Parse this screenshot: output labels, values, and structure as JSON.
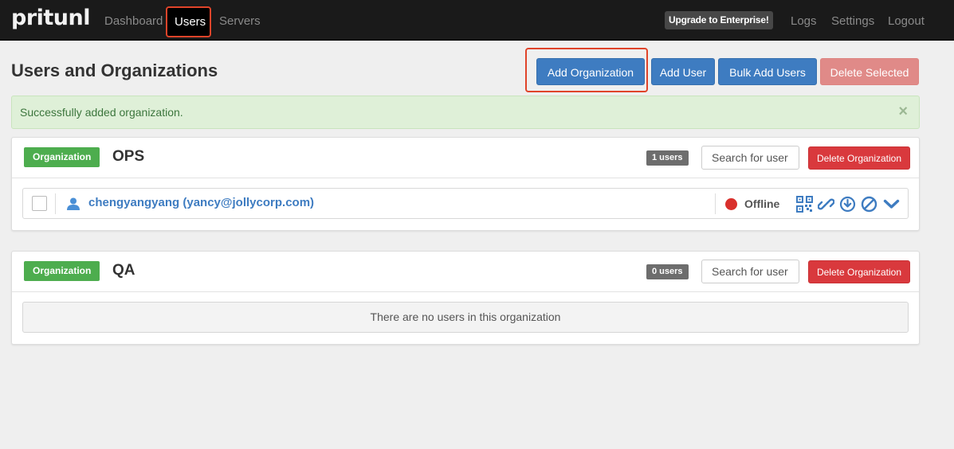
{
  "navbar": {
    "brand": "pritunl",
    "links": [
      "Dashboard",
      "Users",
      "Servers"
    ],
    "upgrade_label": "Upgrade to Enterprise!",
    "right_links": [
      "Logs",
      "Settings",
      "Logout"
    ]
  },
  "page": {
    "title": "Users and Organizations",
    "buttons": {
      "add_organization": "Add Organization",
      "add_user": "Add User",
      "bulk_add_users": "Bulk Add Users",
      "delete_selected": "Delete Selected"
    }
  },
  "alert": {
    "message": "Successfully added organization.",
    "close": "×"
  },
  "organizations": [
    {
      "label": "Organization",
      "name": "OPS",
      "user_count": "1 users",
      "search_placeholder": "Search for user",
      "delete_label": "Delete Organization",
      "users": [
        {
          "name": "chengyangyang (yancy@jollycorp.com)",
          "status": "Offline"
        }
      ]
    },
    {
      "label": "Organization",
      "name": "QA",
      "user_count": "0 users",
      "search_placeholder": "Search for user",
      "delete_label": "Delete Organization",
      "empty_message": "There are no users in this organization"
    }
  ],
  "colors": {
    "primary": "#3e7cc1",
    "danger": "#d9393d",
    "success_label": "#4dad4e",
    "offline": "#d9302c",
    "highlight": "#e0442a"
  }
}
